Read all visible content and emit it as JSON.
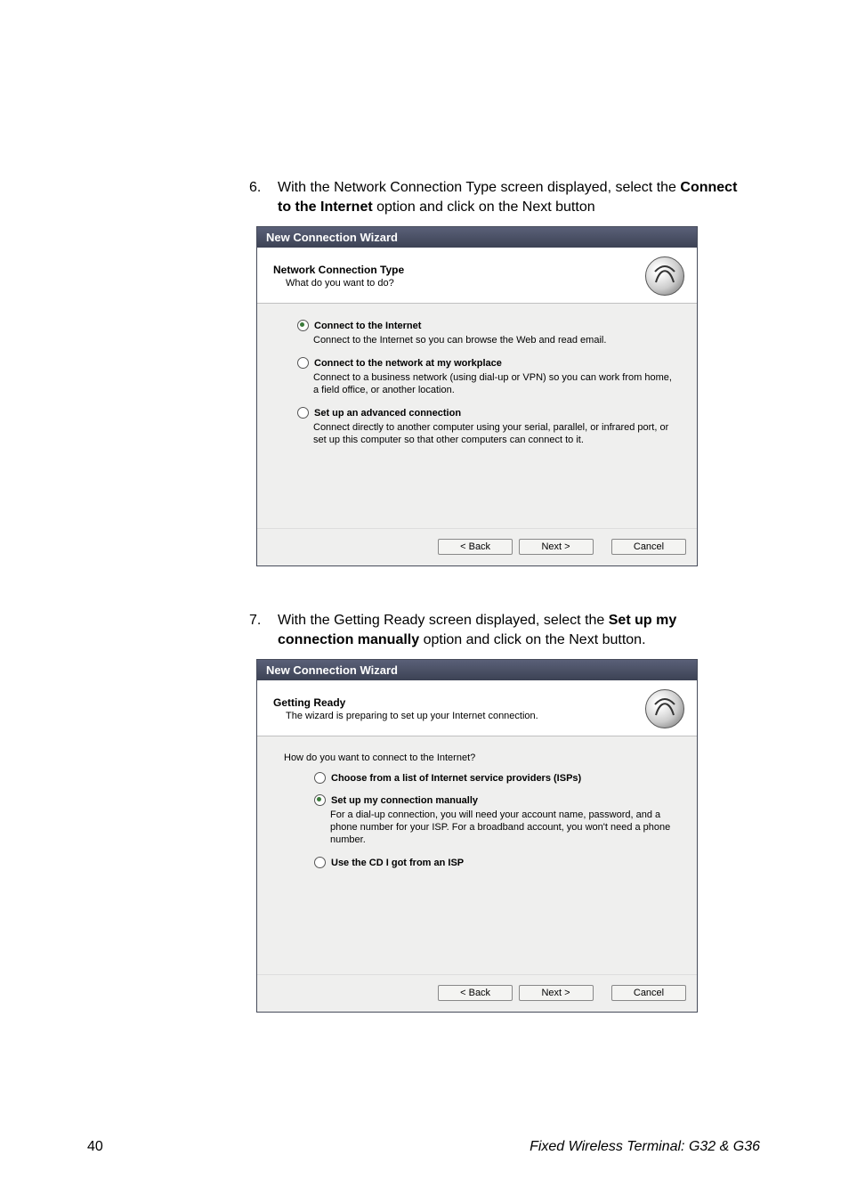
{
  "step6": {
    "number": "6.",
    "text_a": "With the Network Connection Type screen displayed, select the ",
    "text_b": "Connect to the Internet",
    "text_c": " option and click on the Next button"
  },
  "step7": {
    "number": "7.",
    "text_a": "With the Getting Ready screen displayed, select the ",
    "text_b": "Set up my connection manually",
    "text_c": " option and click on the Next button."
  },
  "wizard1": {
    "title": "New Connection Wizard",
    "header_title": "Network Connection Type",
    "header_sub": "What do you want to do?",
    "options": [
      {
        "label": "Connect to the Internet",
        "desc": "Connect to the Internet so you can browse the Web and read email.",
        "selected": true
      },
      {
        "label": "Connect to the network at my workplace",
        "desc": "Connect to a business network (using dial-up or VPN) so you can work from home, a field office, or another location.",
        "selected": false
      },
      {
        "label": "Set up an advanced connection",
        "desc": "Connect directly to another computer using your serial, parallel, or infrared port, or set up this computer so that other computers can connect to it.",
        "selected": false
      }
    ],
    "back": "< Back",
    "next": "Next >",
    "cancel": "Cancel"
  },
  "wizard2": {
    "title": "New Connection Wizard",
    "header_title": "Getting Ready",
    "header_sub": "The wizard is preparing to set up your Internet connection.",
    "question": "How do you want to connect to the Internet?",
    "options": [
      {
        "label": "Choose from a list of Internet service providers (ISPs)",
        "desc": "",
        "selected": false
      },
      {
        "label": "Set up my connection manually",
        "desc": "For a dial-up connection, you will need your account name, password, and a phone number for your ISP. For a broadband account, you won't need a phone number.",
        "selected": true
      },
      {
        "label": "Use the CD I got from an ISP",
        "desc": "",
        "selected": false
      }
    ],
    "back": "< Back",
    "next": "Next >",
    "cancel": "Cancel"
  },
  "footer": {
    "page": "40",
    "title": "Fixed Wireless Terminal: G32 & G36"
  }
}
